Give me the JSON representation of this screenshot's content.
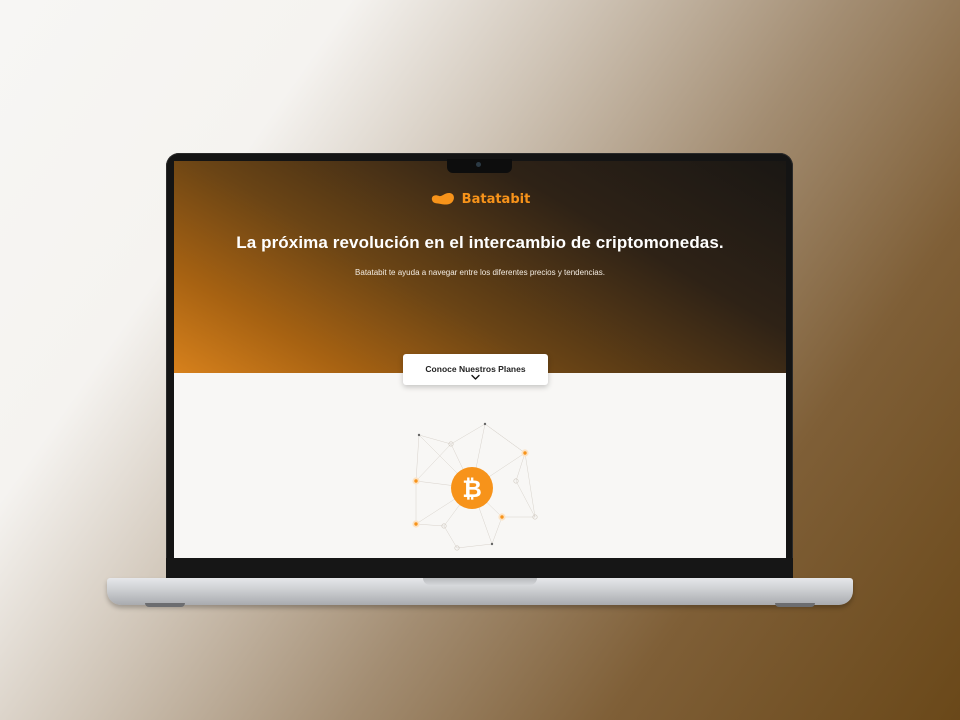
{
  "brand": {
    "name": "Batatabit",
    "accent_color": "#f7931a",
    "logo_icon": "batatabit-logo-icon"
  },
  "hero": {
    "headline": "La próxima revolución en el intercambio de criptomonedas.",
    "subheadline": "Batatabit te ayuda a navegar entre los diferentes precios y tendencias."
  },
  "cta": {
    "label": "Conoce Nuestros Planes",
    "icon": "chevron-down-icon"
  },
  "illustration": {
    "icon": "bitcoin-icon",
    "symbol": "₿"
  }
}
